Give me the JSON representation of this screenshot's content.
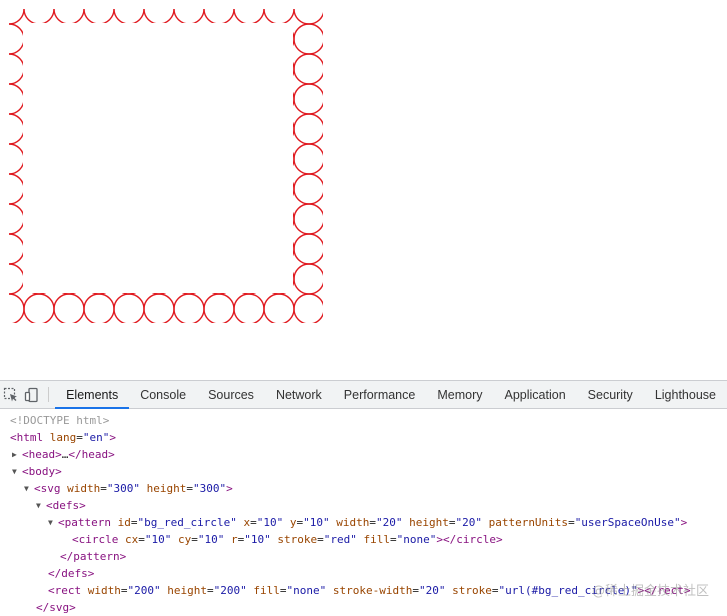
{
  "colors": {
    "stroke": "#e0191f",
    "tab_active_underline": "#1a73e8",
    "tag": "#881280",
    "attr": "#994500",
    "value": "#1a1aa6"
  },
  "toolbar": {
    "inspect_icon": "inspect-element-icon",
    "device_icon": "device-toolbar-icon",
    "tabs": [
      {
        "label": "Elements",
        "active": true
      },
      {
        "label": "Console"
      },
      {
        "label": "Sources"
      },
      {
        "label": "Network"
      },
      {
        "label": "Performance"
      },
      {
        "label": "Memory"
      },
      {
        "label": "Application"
      },
      {
        "label": "Security"
      },
      {
        "label": "Lighthouse"
      }
    ]
  },
  "dom": {
    "doctype": "<!DOCTYPE html>",
    "html_tag": "html",
    "html_lang_attr": "lang",
    "html_lang_val": "\"en\"",
    "head_tag": "head",
    "head_ellipsis": "…",
    "body_tag": "body",
    "svg_tag": "svg",
    "svg_width_attr": "width",
    "svg_width_val": "\"300\"",
    "svg_height_attr": "height",
    "svg_height_val": "\"300\"",
    "defs_tag": "defs",
    "pattern_tag": "pattern",
    "pattern_id_attr": "id",
    "pattern_id_val": "\"bg_red_circle\"",
    "pattern_x_attr": "x",
    "pattern_x_val": "\"10\"",
    "pattern_y_attr": "y",
    "pattern_y_val": "\"10\"",
    "pattern_w_attr": "width",
    "pattern_w_val": "\"20\"",
    "pattern_h_attr": "height",
    "pattern_h_val": "\"20\"",
    "pattern_units_attr": "patternUnits",
    "pattern_units_val": "\"userSpaceOnUse\"",
    "circle_tag": "circle",
    "circle_cx_attr": "cx",
    "circle_cx_val": "\"10\"",
    "circle_cy_attr": "cy",
    "circle_cy_val": "\"10\"",
    "circle_r_attr": "r",
    "circle_r_val": "\"10\"",
    "circle_stroke_attr": "stroke",
    "circle_stroke_val": "\"red\"",
    "circle_fill_attr": "fill",
    "circle_fill_val": "\"none\"",
    "rect_tag": "rect",
    "rect_w_attr": "width",
    "rect_w_val": "\"200\"",
    "rect_h_attr": "height",
    "rect_h_val": "\"200\"",
    "rect_fill_attr": "fill",
    "rect_fill_val": "\"none\"",
    "rect_sw_attr": "stroke-width",
    "rect_sw_val": "\"20\"",
    "rect_stroke_attr": "stroke",
    "rect_stroke_val": "\"url(#bg_red_circle)\""
  },
  "watermark": "@稀土掘金技术社区"
}
